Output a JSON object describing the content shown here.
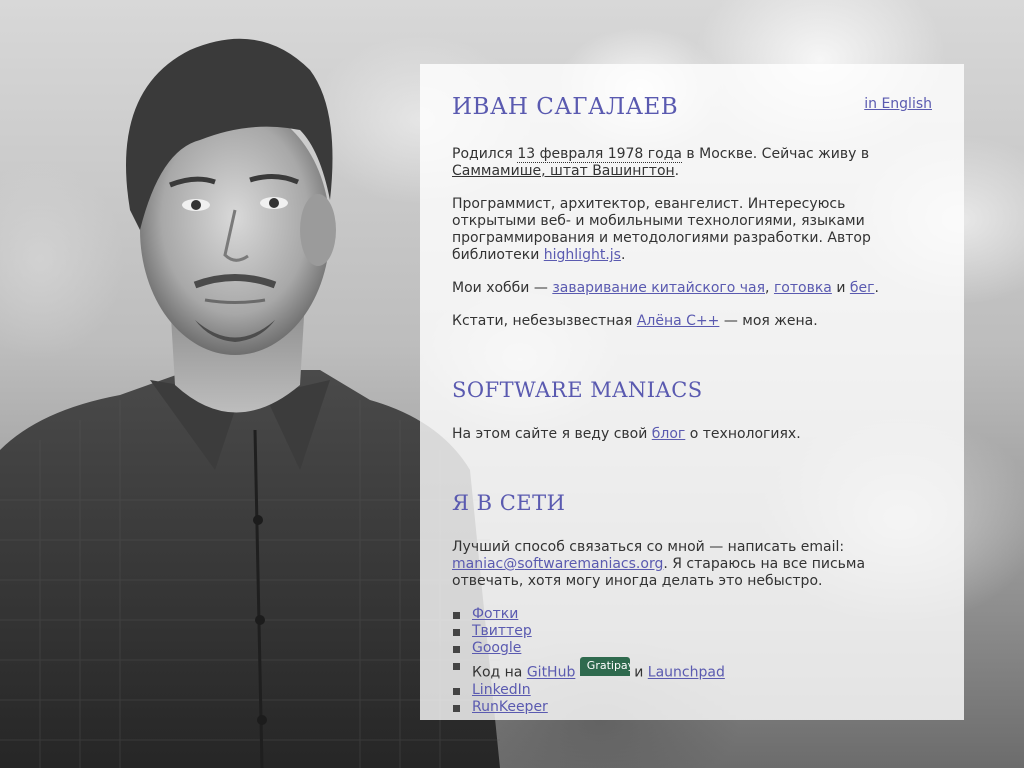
{
  "language_link": "in English",
  "title": "ИВАН САГАЛАЕВ",
  "bio": {
    "born_prefix": "Родился ",
    "born_date": "13 февраля 1978 года",
    "born_mid": " в Москве. Сейчас живу в ",
    "born_place": "Саммамише, штат Вашингтон",
    "born_suffix": ".",
    "work_text": "Программист, архитектор, евангелист. Интересуюсь открытыми веб- и мобильными технологиями, языками программирования и методологиями разработки. Автор библиотеки ",
    "work_link": "highlight.js",
    "work_suffix": ".",
    "hobby_prefix": "Мои хобби — ",
    "hobby_link_1": "заваривание китайского чая",
    "hobby_sep_1": ", ",
    "hobby_link_2": "готовка",
    "hobby_sep_2": " и ",
    "hobby_link_3": "бег",
    "hobby_suffix": ".",
    "wife_prefix": "Кстати, небезызвестная ",
    "wife_link": "Алёна C++",
    "wife_suffix": " — моя жена."
  },
  "section_maniacs": {
    "heading": "SOFTWARE MANIACS",
    "text_prefix": "На этом сайте я веду свой ",
    "text_link": "блог",
    "text_suffix": " о технологиях."
  },
  "section_online": {
    "heading": "Я В СЕТИ",
    "contact_prefix": "Лучший способ связаться со мной — написать email: ",
    "contact_email": "maniac@softwaremaniacs.org",
    "contact_suffix": ". Я стараюсь на все письма отвечать, хотя могу иногда делать это небыстро.",
    "links": {
      "photos": "Фотки",
      "twitter": "Твиттер",
      "google": "Google",
      "code_prefix": "Код на ",
      "github": "GitHub",
      "gratipay": "Gratipay",
      "code_and": " и ",
      "launchpad": "Launchpad",
      "linkedin": "LinkedIn",
      "runkeeper": "RunKeeper"
    }
  },
  "colors": {
    "accent": "#5a5ab0",
    "text": "#333333",
    "panel": "rgba(255,255,255,0.80)",
    "gratipay_badge": "#2f6a4e"
  }
}
